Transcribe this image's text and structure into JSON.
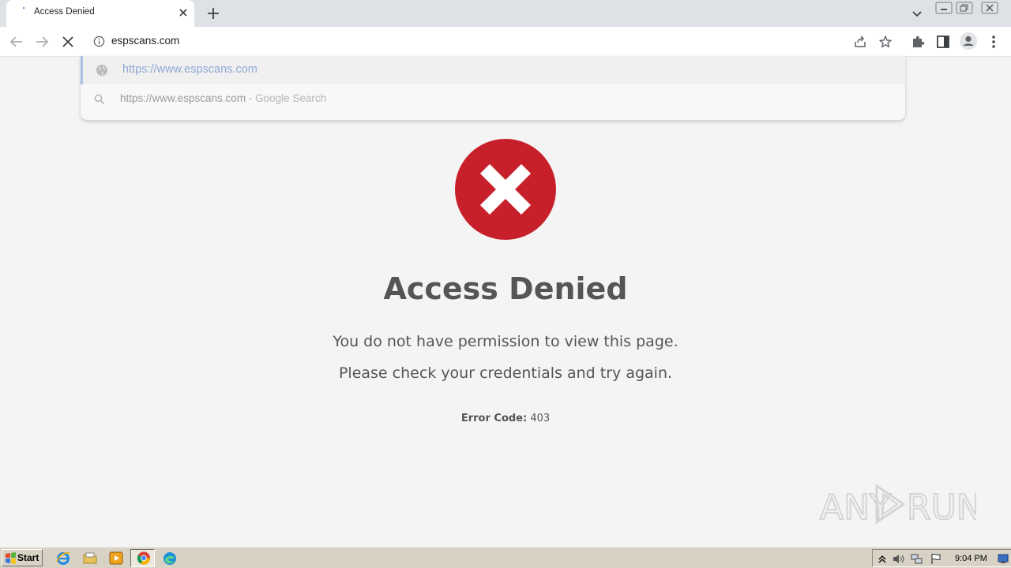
{
  "browser": {
    "tab": {
      "title": "Access Denied"
    },
    "omnibox": {
      "text": "espscans.com"
    },
    "suggestions": [
      {
        "text": "https://www.espscans.com",
        "suffix": "",
        "icon": "globe-icon"
      },
      {
        "text": "https://www.espscans.com",
        "suffix": " - Google Search",
        "icon": "search-icon"
      }
    ]
  },
  "page": {
    "title": "Access Denied",
    "message_1": "You do not have permission to view this page.",
    "message_2": "Please check your credentials and try again.",
    "error_label": "Error Code:",
    "error_value": "403",
    "icon": "error-x-icon",
    "error_color": "#c8202a"
  },
  "watermark": {
    "text_left": "ANY",
    "text_right": "RUN"
  },
  "taskbar": {
    "start_label": "Start",
    "clock": "9:04 PM",
    "apps": [
      "ie-icon",
      "folder-icon",
      "media-player-icon",
      "chrome-icon",
      "edge-icon"
    ]
  }
}
